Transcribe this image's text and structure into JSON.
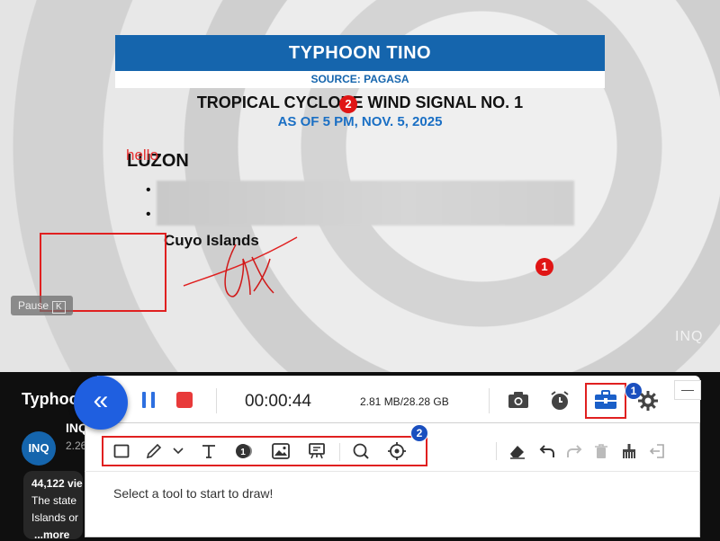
{
  "video": {
    "banner_title": "TYPHOON TINO",
    "banner_source": "SOURCE: PAGASA",
    "signal_title": "TROPICAL CYCLONE WIND SIGNAL NO. 1",
    "signal_date": "AS OF 5 PM, NOV. 5, 2025",
    "region": "LUZON",
    "bullet_1": "•",
    "bullet_2": "•",
    "place": "Cuyo Islands",
    "annotation_text": "hello",
    "marker_1": "1",
    "marker_2": "2",
    "pause_label": "Pause",
    "pause_key": "K",
    "watermark": "INQ"
  },
  "youtube": {
    "title": "Typhoo",
    "channel_avatar": "INQ",
    "channel_name": "INQ",
    "subs": "2.26",
    "views": "44,122 vie",
    "desc_line1": "The state",
    "desc_line2": "Islands or",
    "more": "...more"
  },
  "recorder": {
    "collapse_glyph": "«",
    "timer": "00:00:44",
    "size": "2.81 MB/28.28 GB",
    "badge_toolbox": "1",
    "badge_tools": "2",
    "minimize_glyph": "—",
    "hint": "Select a tool to start to draw!"
  },
  "colors": {
    "accent": "#1f5fe0",
    "record": "#e83a3a",
    "highlight": "#e02020",
    "banner": "#1565ad"
  }
}
